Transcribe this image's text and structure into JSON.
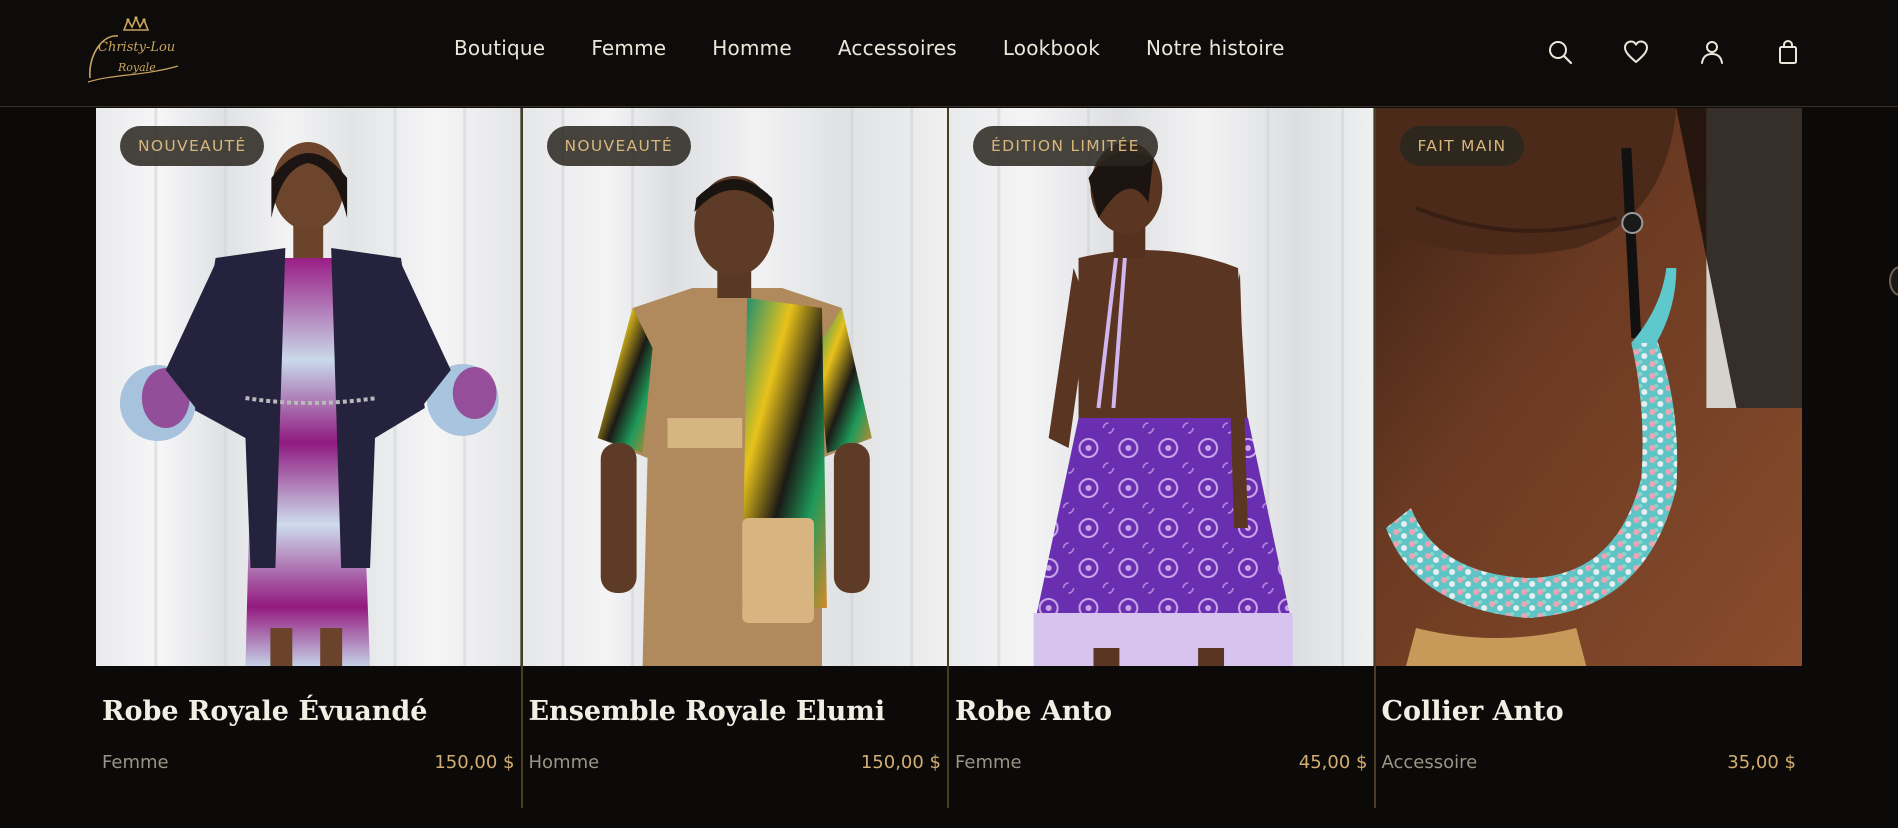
{
  "brand": {
    "logo_lines": [
      "Christy-Lou",
      "Royale"
    ],
    "accent_color": "#c9a45e"
  },
  "nav": {
    "items": [
      "Boutique",
      "Femme",
      "Homme",
      "Accessoires",
      "Lookbook",
      "Notre histoire"
    ]
  },
  "header_icons": [
    "search-icon",
    "heart-icon",
    "user-icon",
    "shopping-bag-icon"
  ],
  "products": [
    {
      "badge": "NOUVEAUTÉ",
      "name": "Robe Royale Évuandé",
      "category": "Femme",
      "price": "150,00 $"
    },
    {
      "badge": "NOUVEAUTÉ",
      "name": "Ensemble Royale Elumi",
      "category": "Homme",
      "price": "150,00 $"
    },
    {
      "badge": "ÉDITION LIMITÉE",
      "name": "Robe Anto",
      "category": "Femme",
      "price": "45,00 $"
    },
    {
      "badge": "FAIT MAIN",
      "name": "Collier Anto",
      "category": "Accessoire",
      "price": "35,00 $"
    }
  ],
  "colors": {
    "background": "#0b0a09",
    "badge_text": "#d9b77c",
    "price": "#d3ad72",
    "divider": "#4a3d26"
  }
}
